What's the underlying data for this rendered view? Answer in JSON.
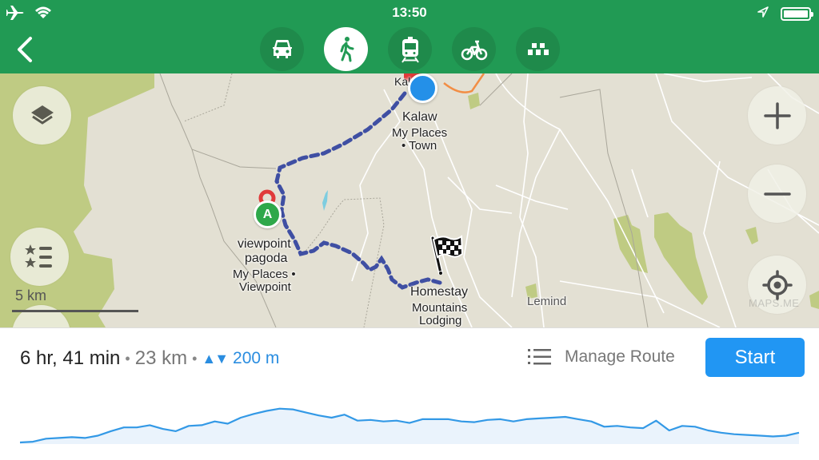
{
  "status_bar": {
    "time": "13:50",
    "left_icons": [
      "airplane-icon",
      "wifi-icon"
    ],
    "right_icons": [
      "location-arrow-icon",
      "battery-icon"
    ],
    "battery_level": 1.0
  },
  "header": {
    "back_icon": "chevron-left-icon",
    "transport_modes": [
      {
        "id": "car",
        "icon": "car-icon",
        "active": false
      },
      {
        "id": "pedestrian",
        "icon": "walking-icon",
        "active": true
      },
      {
        "id": "transit",
        "icon": "train-icon",
        "active": false
      },
      {
        "id": "bicycle",
        "icon": "bicycle-icon",
        "active": false
      },
      {
        "id": "taxi",
        "icon": "taxi-icon",
        "active": false
      }
    ],
    "accent_color": "#219a54"
  },
  "map": {
    "labels": {
      "kalaw_top": "Kalaw",
      "kalaw_title": "Kalaw",
      "kalaw_sub1": "My Places",
      "kalaw_sub2": "• Town",
      "viewpoint_title1": "viewpoint",
      "viewpoint_title2": "pagoda",
      "viewpoint_sub1": "My Places •",
      "viewpoint_sub2": "Viewpoint",
      "homestay_title": "Homestay",
      "homestay_sub1": "Mountains",
      "homestay_sub2": "Lodging",
      "lemind": "Lemind"
    },
    "start_marker_letter": "A",
    "scale_label": "5 km",
    "watermark": "MAPS.ME",
    "route_color": "#3f4fa3",
    "buttons": {
      "layers": "layers-icon",
      "bookmarks": "bookmarks-list-icon",
      "zoom_in": "plus-icon",
      "zoom_out": "minus-icon",
      "my_location": "crosshair-icon"
    }
  },
  "route_summary": {
    "time": "6 hr, 41 min",
    "separator": "•",
    "distance": "23 km",
    "elevation_arrows": "▲▼",
    "elevation": "200 m",
    "manage_route_label": "Manage Route",
    "start_label": "Start",
    "start_color": "#2196f3"
  },
  "elevation_profile": {
    "line_color": "#3399e6",
    "fill_color": "#eaf3fc",
    "relative_heights": [
      0.0,
      0.02,
      0.1,
      0.12,
      0.14,
      0.12,
      0.18,
      0.3,
      0.4,
      0.4,
      0.46,
      0.36,
      0.3,
      0.44,
      0.46,
      0.56,
      0.5,
      0.66,
      0.76,
      0.84,
      0.9,
      0.88,
      0.8,
      0.72,
      0.66,
      0.74,
      0.58,
      0.6,
      0.56,
      0.58,
      0.52,
      0.62,
      0.62,
      0.62,
      0.56,
      0.54,
      0.6,
      0.62,
      0.56,
      0.62,
      0.64,
      0.66,
      0.68,
      0.62,
      0.56,
      0.42,
      0.44,
      0.4,
      0.38,
      0.58,
      0.32,
      0.44,
      0.42,
      0.32,
      0.26,
      0.22,
      0.2,
      0.18,
      0.16,
      0.18,
      0.26
    ]
  }
}
